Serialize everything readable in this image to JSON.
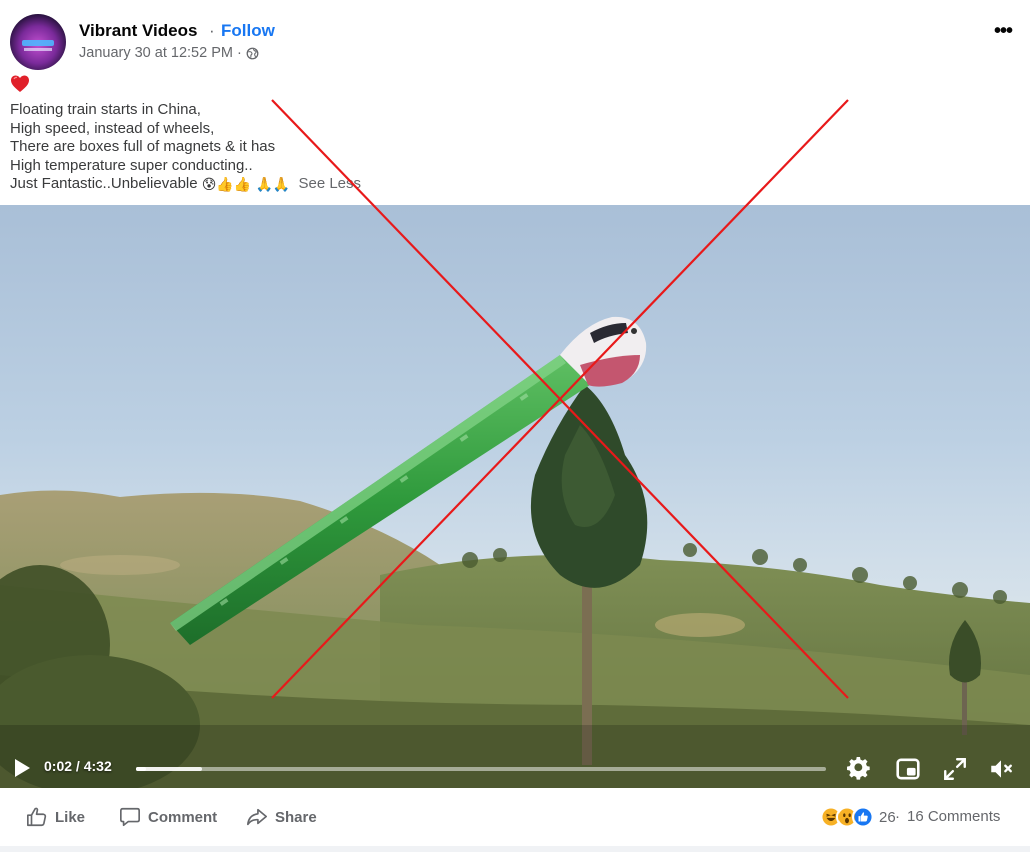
{
  "post": {
    "page_name": "Vibrant Videos",
    "separator": "·",
    "follow_label": "Follow",
    "timestamp": "January 30 at 12:52 PM",
    "meta_separator": "·",
    "audience_icon": "globe-icon",
    "more_icon": "more-options-icon",
    "more_glyph": "•••",
    "heart_emoji": "red-heart-icon",
    "caption_lines": [
      "Floating train starts in China,",
      "High speed, instead of wheels,",
      "There are boxes full of magnets & it has",
      "High temperature super conducting..",
      "Just Fantastic..Unbelievable"
    ],
    "caption_emojis": [
      "😰",
      "👍",
      "👍",
      "🙏",
      "🙏"
    ],
    "see_less_label": "See Less"
  },
  "video": {
    "current_time": "0:02",
    "duration": "4:32",
    "time_separator": " / ",
    "progress": 0.014,
    "buffered": 0.095,
    "controls": [
      "play-icon",
      "settings-gear-icon",
      "picture-in-picture-icon",
      "fullscreen-icon",
      "volume-muted-icon"
    ]
  },
  "actions": {
    "like_label": "Like",
    "comment_label": "Comment",
    "share_label": "Share"
  },
  "stats": {
    "reaction_icons": [
      "haha-reaction-icon",
      "wow-reaction-icon",
      "like-reaction-icon"
    ],
    "reaction_count": "26",
    "separator": "·",
    "comments_label": "16 Comments"
  },
  "colors": {
    "link_blue": "#1877f2",
    "secondary_text": "#65676b",
    "overlay_red": "#e8191a"
  }
}
